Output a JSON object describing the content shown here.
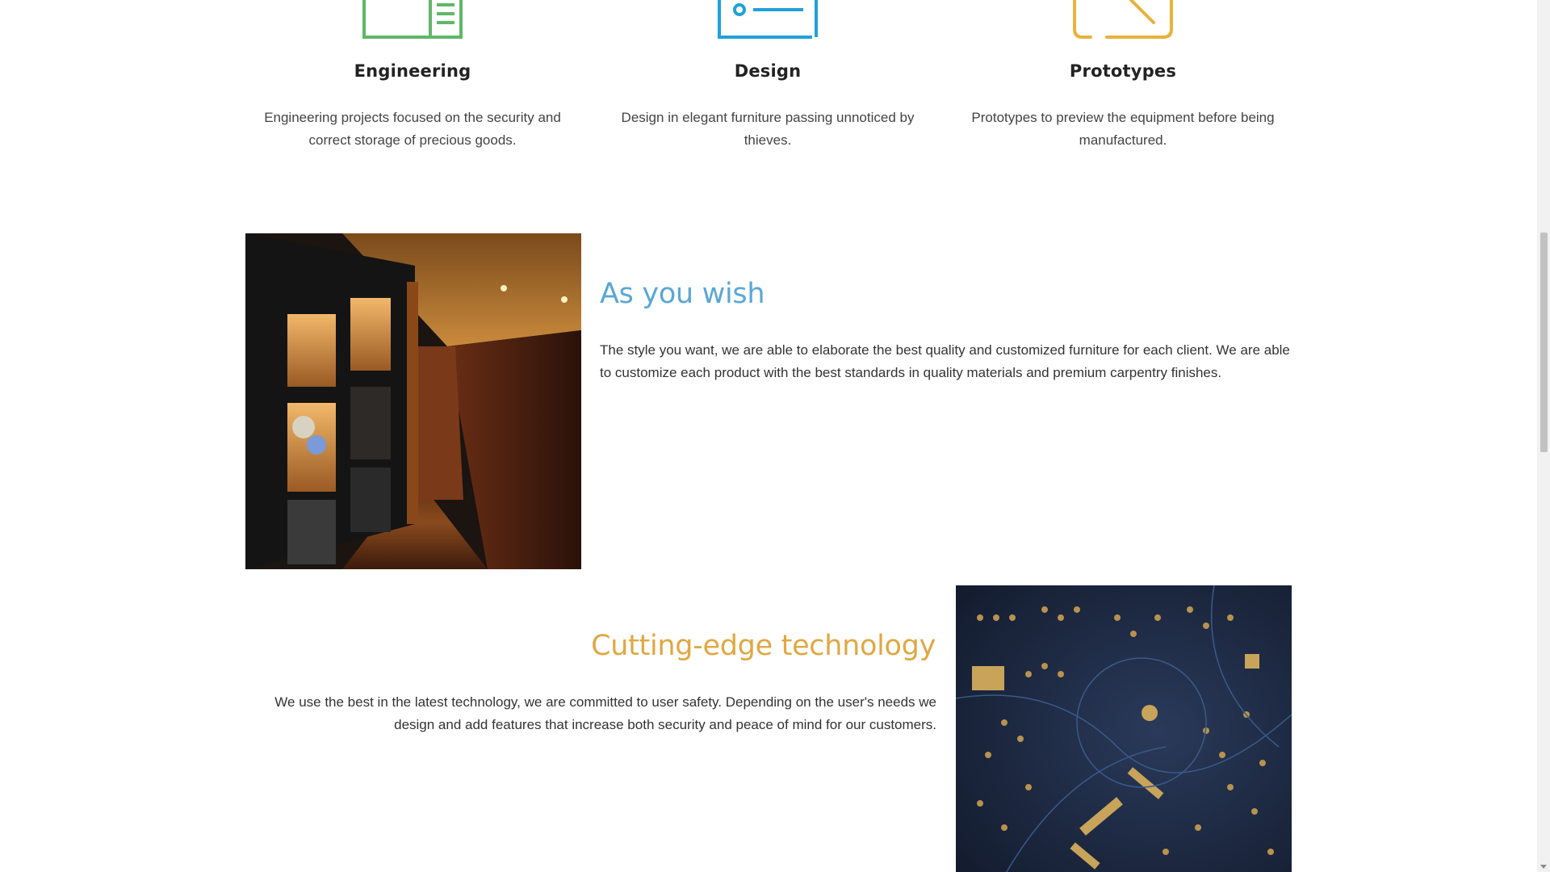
{
  "features": [
    {
      "title": "Engineering",
      "description": "Engineering projects focused on the security and correct storage of precious goods.",
      "icon": "blueprint-icon",
      "color": "#5fb868"
    },
    {
      "title": "Design",
      "description": "Design in elegant furniture passing unnoticed by thieves.",
      "icon": "design-card-icon",
      "color": "#1fa2d8"
    },
    {
      "title": "Prototypes",
      "description": "Prototypes to preview the equipment before being manufactured.",
      "icon": "prototype-arrow-icon",
      "color": "#e8b23c"
    }
  ],
  "sections": [
    {
      "title": "As you wish",
      "text": "The style you want, we are able to elaborate the best quality and customized furniture for each client. We are able to customize each product with the best standards in quality materials and premium carpentry finishes.",
      "title_color": "#5aa7d6",
      "image": "wood-interior-shelves-photo"
    },
    {
      "title": "Cutting-edge technology",
      "text": "We use the best in the latest technology, we are committed to user safety. Depending on the user's needs we design and add features that increase both security and peace of mind for our customers.",
      "title_color": "#e0a842",
      "image": "circuit-board-photo"
    }
  ]
}
